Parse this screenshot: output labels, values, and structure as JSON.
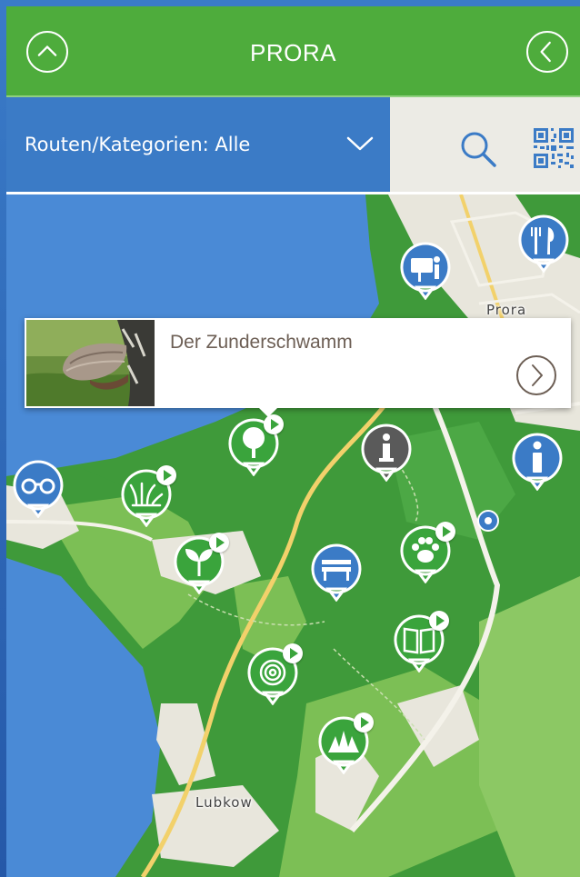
{
  "header": {
    "title": "PRORA",
    "left_button_icon": "chevron-up-circle-icon",
    "right_button_icon": "chevron-left-circle-icon"
  },
  "filter": {
    "label": "Routen/Kategorien: Alle",
    "dropdown_icon": "chevron-down-icon"
  },
  "tools": {
    "search_icon": "search-icon",
    "qr_icon": "qr-code-icon"
  },
  "map": {
    "places": [
      "Prora",
      "Lubkow"
    ],
    "popup": {
      "title": "Der Zunderschwamm",
      "image": "tinder-fungus-photo",
      "arrow_icon": "chevron-right-circle-icon"
    },
    "markers": [
      {
        "name": "restaurant-marker",
        "icon": "fork-knife-icon",
        "color": "#3b7bc6"
      },
      {
        "name": "info-board-marker",
        "icon": "info-board-icon",
        "color": "#3b7bc6"
      },
      {
        "name": "info-marker-gray",
        "icon": "info-icon",
        "color": "#5a5a5a"
      },
      {
        "name": "info-marker-blue",
        "icon": "info-icon",
        "color": "#3b7bc6"
      },
      {
        "name": "binoculars-marker",
        "icon": "binoculars-icon",
        "color": "#3b7bc6"
      },
      {
        "name": "tree-marker",
        "icon": "tree-icon",
        "color": "#3aa43c"
      },
      {
        "name": "grass-marker",
        "icon": "grass-icon",
        "color": "#3aa43c"
      },
      {
        "name": "sprout-marker",
        "icon": "sprout-icon",
        "color": "#3aa43c"
      },
      {
        "name": "bench-marker",
        "icon": "bench-icon",
        "color": "#3b7bc6"
      },
      {
        "name": "paw-marker",
        "icon": "paw-icon",
        "color": "#3aa43c"
      },
      {
        "name": "book-marker",
        "icon": "book-icon",
        "color": "#3aa43c"
      },
      {
        "name": "snail-marker",
        "icon": "snail-icon",
        "color": "#3aa43c"
      },
      {
        "name": "grass-marker-2",
        "icon": "grass-icon",
        "color": "#3aa43c"
      },
      {
        "name": "location-dot",
        "icon": "location-dot-icon",
        "color": "#3b7bc6"
      }
    ]
  },
  "colors": {
    "header_green": "#4eac3c",
    "filter_blue": "#3b7bc6",
    "water": "#4a8ad6",
    "forest": "#3f9a3a",
    "meadow": "#7cbf55"
  }
}
